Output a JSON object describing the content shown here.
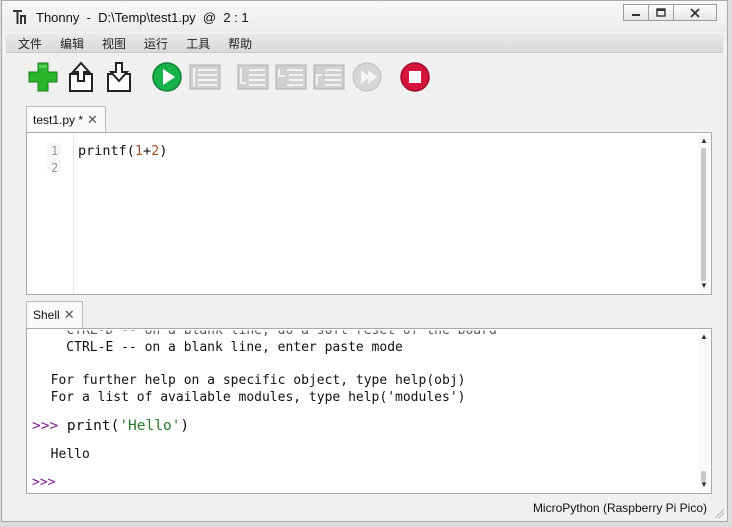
{
  "window": {
    "title": "Thonny  -  D:\\Temp\\test1.py  @  2 : 1",
    "minimize_icon": "minimize-icon",
    "maximize_icon": "maximize-icon",
    "close_icon": "close-icon"
  },
  "menu": [
    "文件",
    "编辑",
    "视图",
    "运行",
    "工具",
    "帮助"
  ],
  "toolbar": {
    "icons": [
      "new-file-icon",
      "open-file-icon",
      "save-file-icon",
      "run-icon",
      "debug-icon",
      "step-over-icon",
      "step-into-icon",
      "step-out-icon",
      "resume-icon",
      "stop-icon"
    ],
    "colors": {
      "new": "#2bb52b",
      "run": "#17b34a",
      "stop": "#d4143c",
      "disabled": "#b8b8b8"
    }
  },
  "editor": {
    "tab_label": "test1.py *",
    "tab_close": "✕",
    "line_numbers": [
      "1",
      "2"
    ],
    "code": {
      "fn": "printf(",
      "a": "1",
      "op": "+",
      "b": "2",
      "close": ")"
    }
  },
  "shell": {
    "tab_label": "Shell",
    "tab_close": "✕",
    "cut_line": "    CTRL-D -- on a blank line, do a soft reset of the board",
    "lines": [
      "    CTRL-E -- on a blank line, enter paste mode",
      "  For further help on a specific object, type help(obj)",
      "  For a list of available modules, type help('modules')"
    ],
    "prompt": ">>>",
    "cmd_fn": " print(",
    "cmd_str": "'Hello'",
    "cmd_close": ")",
    "output": "  Hello",
    "final_prompt": ">>>"
  },
  "status": {
    "interpreter": "MicroPython (Raspberry Pi Pico)"
  }
}
